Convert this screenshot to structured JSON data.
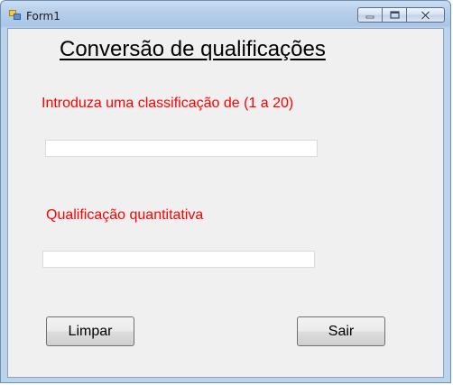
{
  "window": {
    "title": "Form1",
    "controls": {
      "minimize": "minimize",
      "maximize": "maximize",
      "close": "close"
    }
  },
  "form": {
    "heading": "Conversão de qualificações",
    "input_label": "Introduza uma classificação de (1 a 20)",
    "input_value": "",
    "output_label": "Qualificação quantitativa",
    "output_value": "",
    "clear_button": "Limpar",
    "exit_button": "Sair"
  },
  "colors": {
    "label_red": "#ff0000",
    "form_background": "#f0f0f0"
  }
}
